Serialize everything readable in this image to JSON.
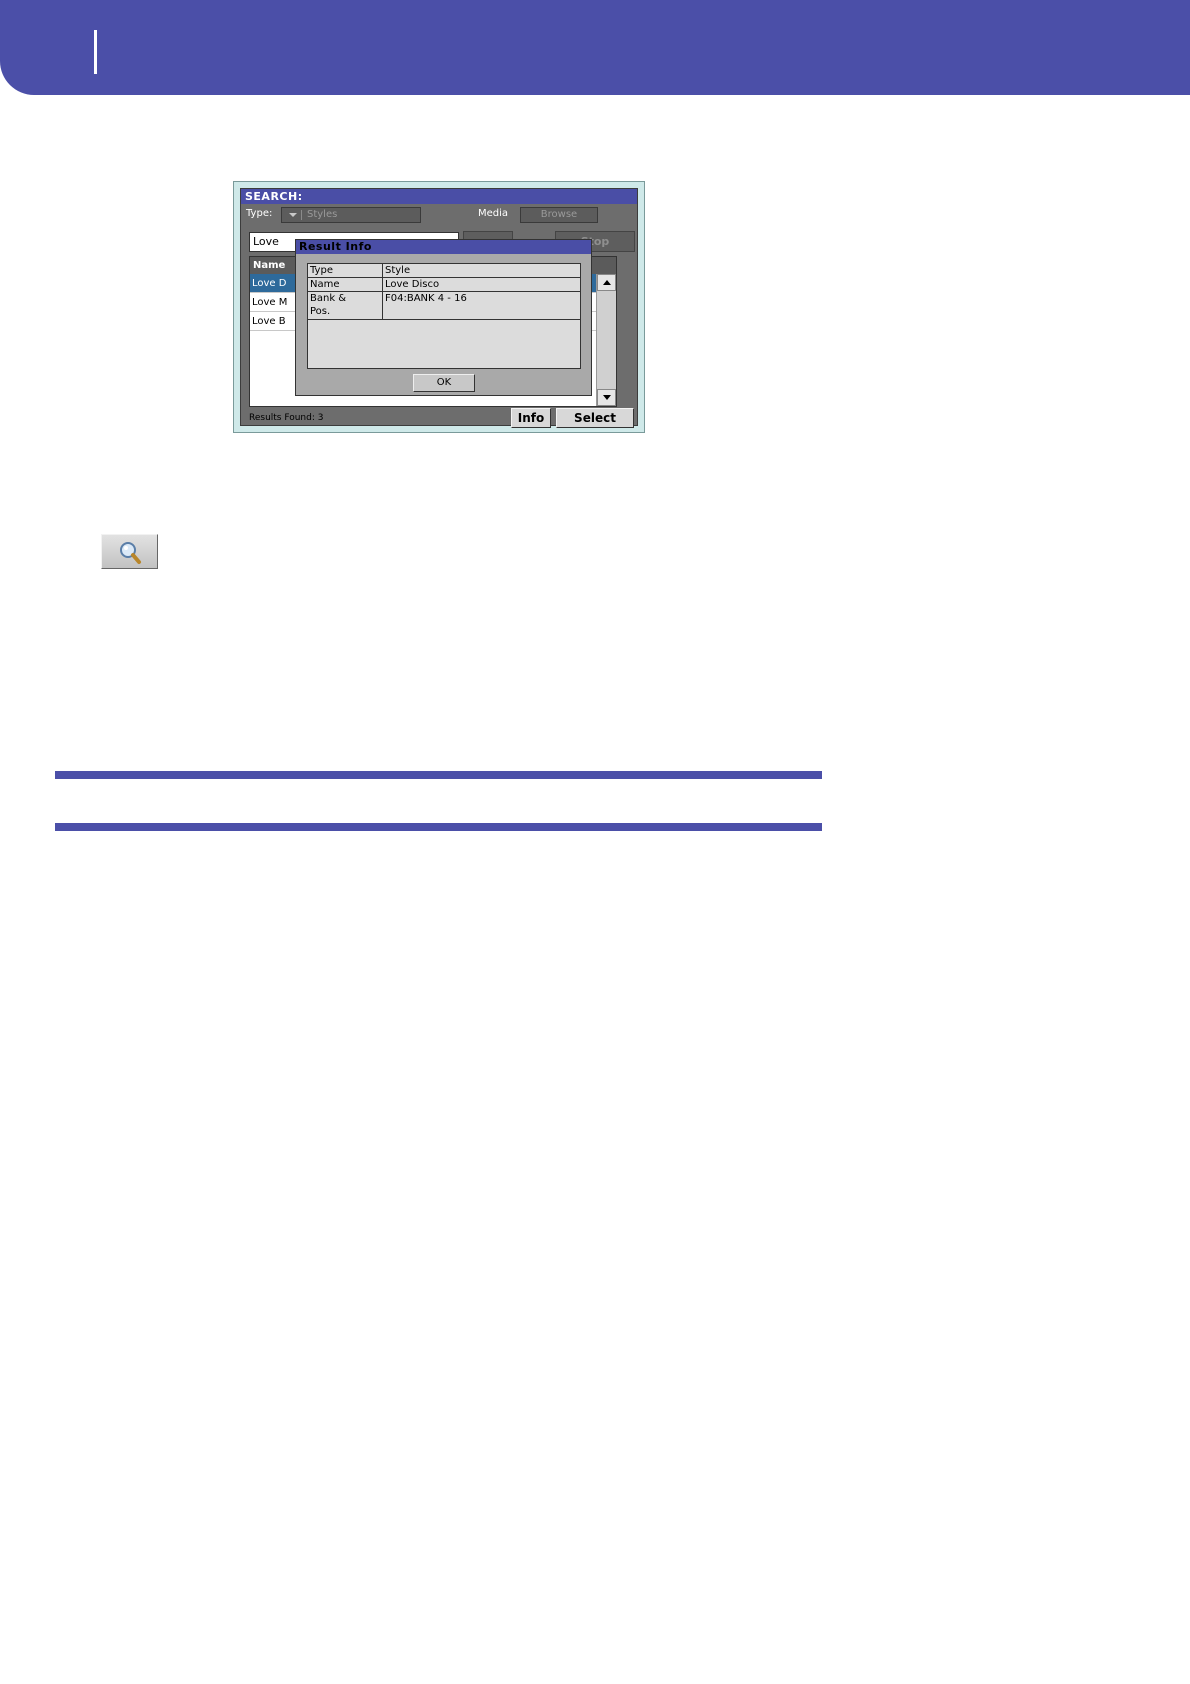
{
  "colors": {
    "brand": "#4b4fa8",
    "selection": "#2e6a9b"
  },
  "search_window": {
    "title": "SEARCH:",
    "type_label": "Type:",
    "type_value": "Styles",
    "media_label": "Media",
    "browse_label": "Browse",
    "query": "Love",
    "stop_label": "Stop",
    "column_header": "Name",
    "results": [
      {
        "name": "Love D",
        "selected": true
      },
      {
        "name": "Love M",
        "selected": false
      },
      {
        "name": "Love B",
        "selected": false
      }
    ],
    "status_text": "Results Found:  3",
    "info_label": "Info",
    "select_label": "Select"
  },
  "result_info": {
    "title": "Result Info",
    "rows": [
      {
        "key": "Type",
        "value": "Style"
      },
      {
        "key": "Name",
        "value": "Love Disco"
      },
      {
        "key": "Bank & Pos.",
        "value": "F04:BANK 4 - 16"
      }
    ],
    "ok_label": "OK"
  },
  "icons": {
    "search_button": "magnifier-icon",
    "scroll_up": "arrow-up-icon",
    "scroll_down": "arrow-down-icon",
    "type_dropdown": "chevron-down-icon"
  }
}
